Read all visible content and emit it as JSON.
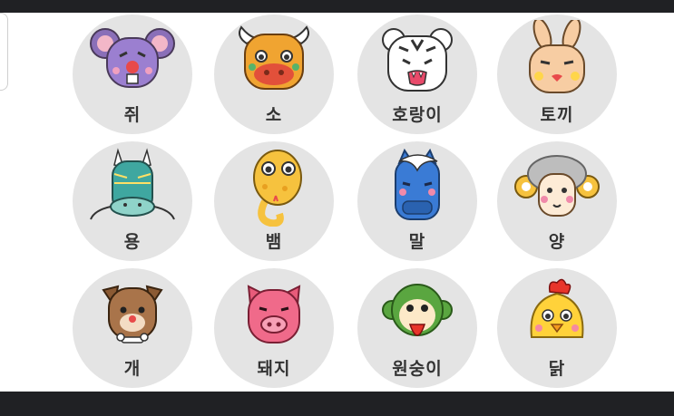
{
  "zodiac": [
    {
      "label": "쥐",
      "icon": "rat-face-icon"
    },
    {
      "label": "소",
      "icon": "ox-face-icon"
    },
    {
      "label": "호랑이",
      "icon": "tiger-face-icon"
    },
    {
      "label": "토끼",
      "icon": "rabbit-face-icon"
    },
    {
      "label": "용",
      "icon": "dragon-face-icon"
    },
    {
      "label": "뱀",
      "icon": "snake-face-icon"
    },
    {
      "label": "말",
      "icon": "horse-face-icon"
    },
    {
      "label": "양",
      "icon": "sheep-face-icon"
    },
    {
      "label": "개",
      "icon": "dog-face-icon"
    },
    {
      "label": "돼지",
      "icon": "pig-face-icon"
    },
    {
      "label": "원숭이",
      "icon": "monkey-face-icon"
    },
    {
      "label": "닭",
      "icon": "rooster-face-icon"
    }
  ],
  "colors": {
    "tile": "#e4e4e4",
    "label": "#333333",
    "bar": "#202124"
  }
}
